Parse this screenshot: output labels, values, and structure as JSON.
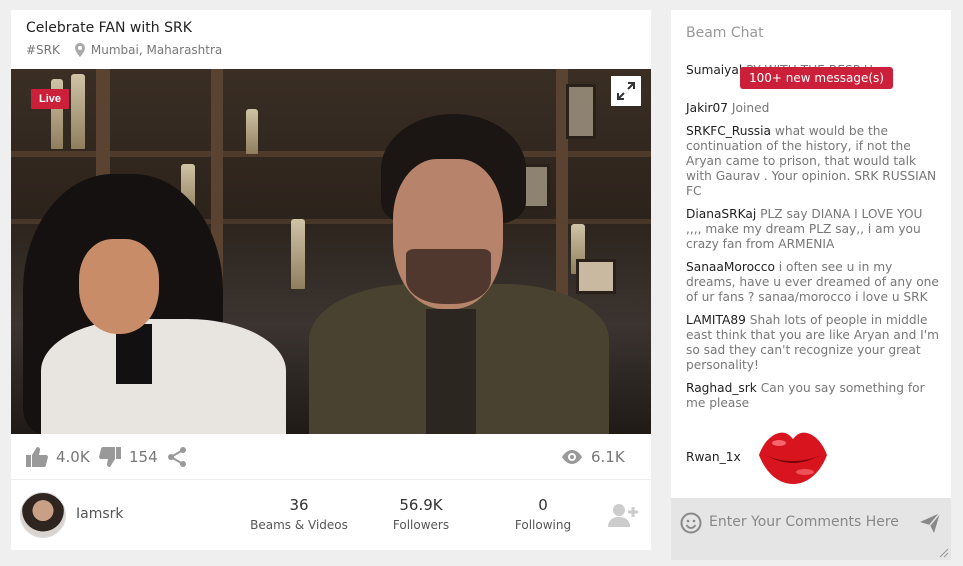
{
  "stream": {
    "title": "Celebrate FAN with SRK",
    "hashtag": "#SRK",
    "location": "Mumbai, Maharashtra",
    "live_label": "Live"
  },
  "actions": {
    "likes": "4.0K",
    "dislikes": "154",
    "views": "6.1K"
  },
  "profile": {
    "username": "Iamsrk",
    "stats": [
      {
        "value": "36",
        "label": "Beams & Videos"
      },
      {
        "value": "56.9K",
        "label": "Followers"
      },
      {
        "value": "0",
        "label": "Following"
      }
    ]
  },
  "chat": {
    "title": "Beam Chat",
    "new_messages_badge": "100+ new message(s)",
    "messages": [
      {
        "user": "Sumaiyal",
        "text": "PY WITH THE RESP U"
      },
      {
        "user": "Jakir07",
        "text": "Joined"
      },
      {
        "user": "SRKFC_Russia",
        "text": "what would be the continuation of the history, if not the Aryan came to prison, that would talk with Gaurav . Your opinion. SRK RUSSIAN FC"
      },
      {
        "user": "DianaSRKaj",
        "text": "PLZ say DIANA I LOVE YOU ,,,, make my dream PLZ say,, i am you crazy fan from ARMENIA"
      },
      {
        "user": "SanaaMorocco",
        "text": "i often see u in my dreams, have u ever dreamed of any one of ur fans ? sanaa/morocco i love u SRK"
      },
      {
        "user": "LAMITA89",
        "text": "Shah lots of people in middle east think that you are like Aryan and I'm so sad they can't recognize your great personality!"
      },
      {
        "user": "Raghad_srk",
        "text": "Can you say something for me please"
      }
    ],
    "sticker_message": {
      "user": "Rwan_1x"
    },
    "input_placeholder": "Enter Your Comments Here"
  },
  "colors": {
    "accent": "#cc1f3a",
    "page_bg": "#efefef",
    "input_bar_bg": "#e5e5e5"
  },
  "icons": [
    "location-pin-icon",
    "fullscreen-icon",
    "thumbs-up-icon",
    "thumbs-down-icon",
    "share-icon",
    "eye-icon",
    "add-user-icon",
    "emoji-icon",
    "send-icon"
  ]
}
